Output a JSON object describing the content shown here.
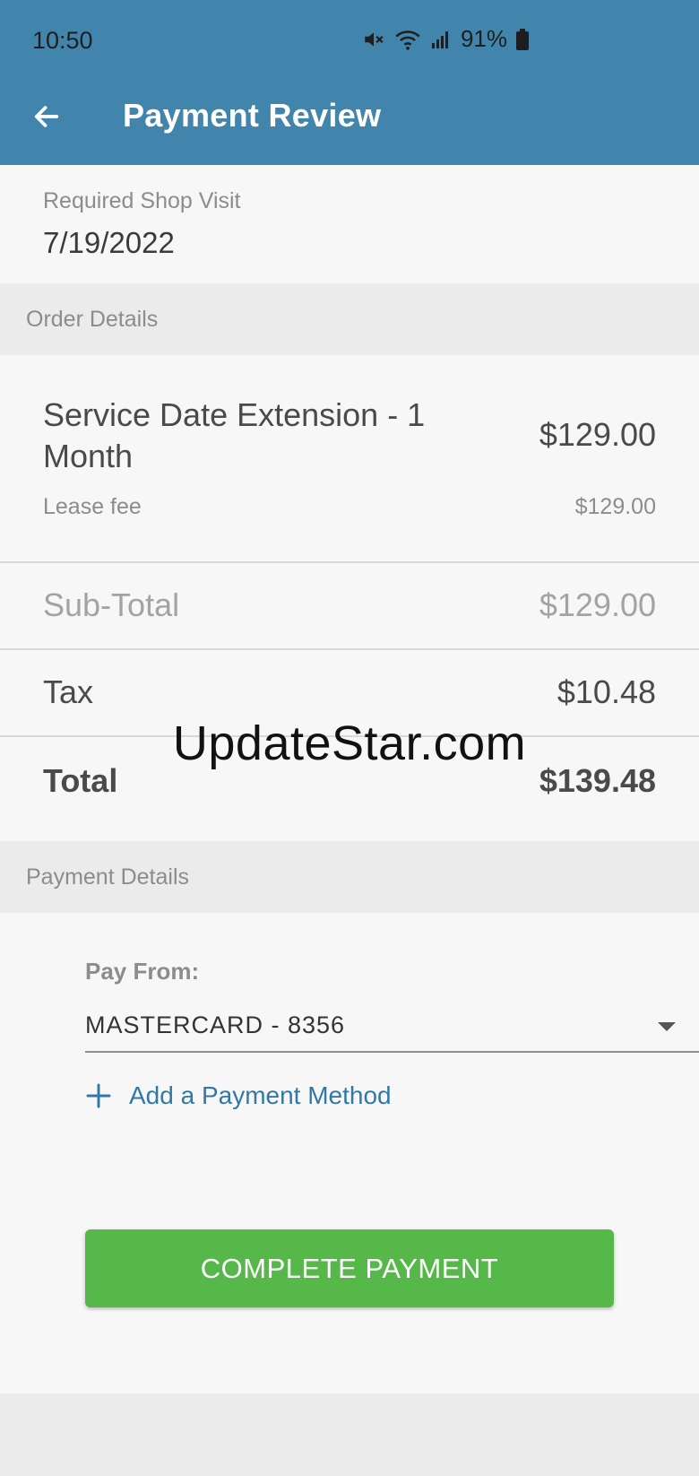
{
  "status_bar": {
    "time": "10:50",
    "battery": "91%",
    "icons": [
      "mute-icon",
      "wifi-icon",
      "signal-icon",
      "battery-icon"
    ]
  },
  "header": {
    "title": "Payment Review",
    "back_icon": "arrow-left-icon",
    "color": "#4185ad"
  },
  "shop_visit": {
    "label": "Required Shop Visit",
    "date": "7/19/2022"
  },
  "order": {
    "section_title": "Order Details",
    "item": {
      "name_line1": "Service Date Extension - 1",
      "name_line2": "Month",
      "price": "$129.00",
      "sub_label": "Lease fee",
      "sub_price": "$129.00"
    },
    "subtotal_label": "Sub-Total",
    "subtotal_value": "$129.00",
    "tax_label": "Tax",
    "tax_value": "$10.48",
    "total_label": "Total",
    "total_value": "$139.48"
  },
  "watermark": "UpdateStar.com",
  "payment": {
    "section_title": "Payment Details",
    "pay_from_label": "Pay From:",
    "selected_method": "MASTERCARD - 8356",
    "add_method_label": "Add a Payment Method",
    "complete_button": "COMPLETE PAYMENT",
    "accent": "#3179a4",
    "button_color": "#55b848"
  }
}
